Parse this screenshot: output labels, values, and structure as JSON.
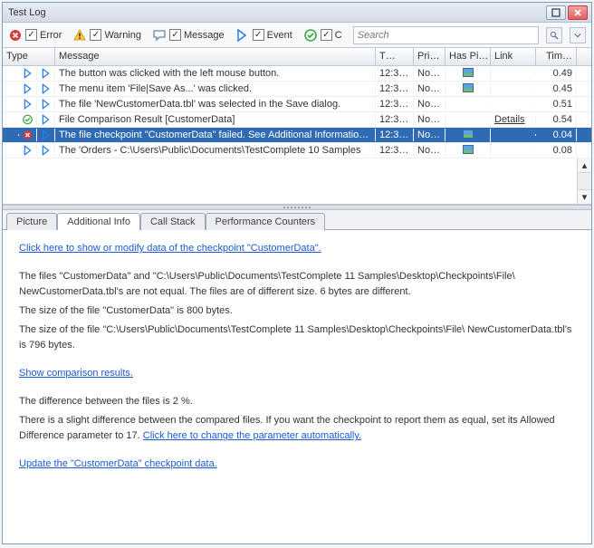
{
  "window": {
    "title": "Test Log"
  },
  "filters": {
    "error": "Error",
    "warning": "Warning",
    "message": "Message",
    "event": "Event",
    "c": "C"
  },
  "search": {
    "placeholder": "Search"
  },
  "grid": {
    "headers": {
      "type": "Type",
      "message": "Message",
      "t": "T…",
      "pri": "Pri…",
      "haspic": "Has Pi…",
      "link": "Link",
      "tim": "Tim…"
    },
    "rows": [
      {
        "icon": "event",
        "msg": "The button was clicked with the left mouse button.",
        "t": "12:3…",
        "pri": "No…",
        "pic": true,
        "link": "",
        "tim": "0.49"
      },
      {
        "icon": "event",
        "msg": "The menu item 'File|Save As...' was clicked.",
        "t": "12:3…",
        "pri": "No…",
        "pic": true,
        "link": "",
        "tim": "0.45"
      },
      {
        "icon": "event",
        "msg": "The file 'NewCustomerData.tbl' was selected in the Save dialog.",
        "t": "12:3…",
        "pri": "No…",
        "pic": false,
        "link": "",
        "tim": "0.51"
      },
      {
        "icon": "check",
        "msg": "File Comparison Result [CustomerData]",
        "t": "12:3…",
        "pri": "No…",
        "pic": false,
        "link": "Details",
        "tim": "0.54"
      },
      {
        "icon": "error",
        "msg": "The file checkpoint \"CustomerData\" failed. See Additional Information for d…",
        "t": "12:3…",
        "pri": "No…",
        "pic": true,
        "link": "",
        "tim": "0.04",
        "selected": true
      },
      {
        "icon": "event",
        "msg": "The 'Orders - C:\\Users\\Public\\Documents\\TestComplete 10 Samples",
        "t": "12:3…",
        "pri": "No…",
        "pic": true,
        "link": "",
        "tim": "0.08"
      }
    ]
  },
  "tabs": {
    "items": [
      "Picture",
      "Additional Info",
      "Call Stack",
      "Performance Counters"
    ],
    "active": 1
  },
  "info": {
    "link_show": "Click here to show or modify data of the checkpoint \"CustomerData\".",
    "p1": "The files \"CustomerData\" and \"C:\\Users\\Public\\Documents\\TestComplete 11 Samples\\Desktop\\Checkpoints\\File\\ NewCustomerData.tbl's are not equal. The files are of different size. 6 bytes are different.",
    "p2": "The size of the file \"CustomerData\" is 800 bytes.",
    "p3": "The size of the file \"C:\\Users\\Public\\Documents\\TestComplete 11 Samples\\Desktop\\Checkpoints\\File\\ NewCustomerData.tbl's is 796 bytes.",
    "link_compare": "Show comparison results.",
    "p4": "The difference between the files is 2 %.",
    "p5a": "There is a slight difference between the compared files. If you want the checkpoint to report them as equal, set its Allowed Difference parameter to 17. ",
    "link_change": "Click here to change the parameter automatically.",
    "link_update": "Update the \"CustomerData\" checkpoint data."
  }
}
